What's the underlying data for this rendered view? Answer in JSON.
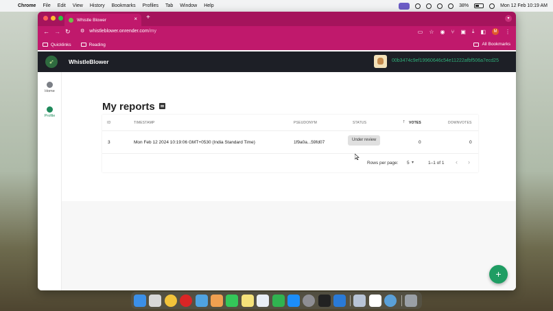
{
  "menubar": {
    "app": "Chrome",
    "items": [
      "File",
      "Edit",
      "View",
      "History",
      "Bookmarks",
      "Profiles",
      "Tab",
      "Window",
      "Help"
    ],
    "battery": "38%",
    "datetime": "Mon 12 Feb  10:19 AM"
  },
  "browser": {
    "tab_title": "Whistle Blower",
    "url_host": "whistleblower.onrender.com",
    "url_path": "/my",
    "bookmarks": [
      "Quicklinks",
      "Reading"
    ],
    "all_bookmarks": "All Bookmarks",
    "avatar_letter": "M"
  },
  "app": {
    "brand": "WhistleBlower",
    "wallet_address": "00b3474c9ef19960646c54e11222afbf506a7ecd25"
  },
  "sidebar": {
    "items": [
      {
        "label": "Home",
        "icon": "home-icon"
      },
      {
        "label": "Profile",
        "icon": "profile-icon",
        "active": true
      }
    ]
  },
  "page": {
    "title": "My reports",
    "columns": [
      "ID",
      "TIMESTAMP",
      "PSEUDONYM",
      "STATUS",
      "VOTES",
      "DOWNVOTES"
    ],
    "rows": [
      {
        "id": "3",
        "timestamp": "Mon Feb 12 2024 10:19:06 GMT+0530 (India Standard Time)",
        "pseudonym": "1f9a0a...59fd07",
        "status": "Under review",
        "votes": "0",
        "downvotes": "0"
      }
    ],
    "pagination": {
      "rows_per_page_label": "Rows per page:",
      "rows_per_page": "5",
      "range": "1–1 of 1"
    },
    "fab": "+"
  },
  "colors": {
    "chrome_accent": "#c0196c",
    "app_bar": "#1d1f26",
    "brand_green": "#1f9d63",
    "wallet_green": "#2fb07a"
  }
}
